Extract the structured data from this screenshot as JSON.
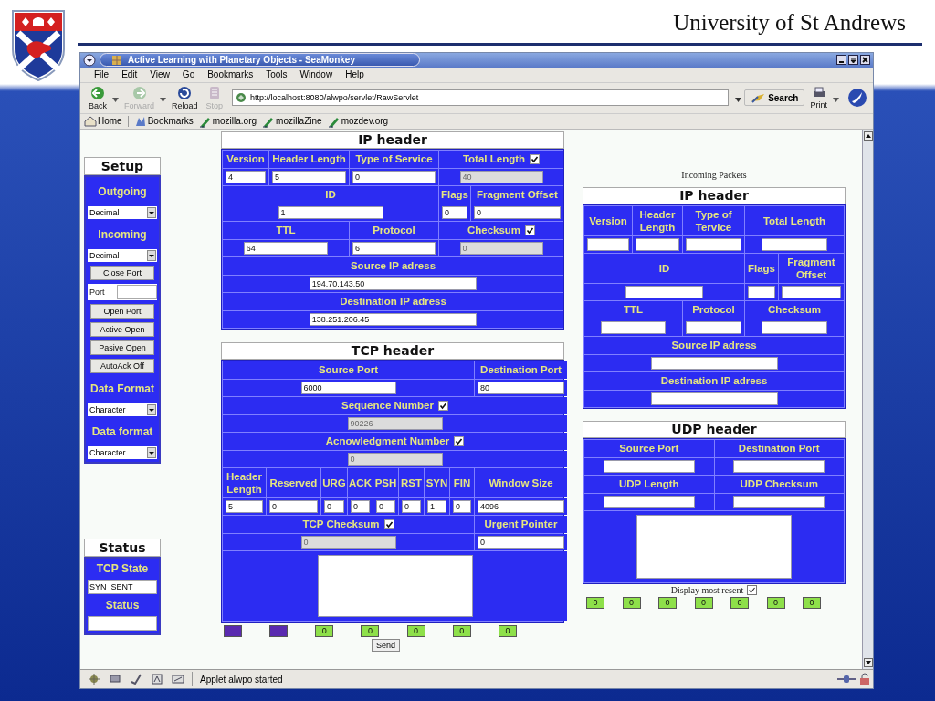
{
  "slide": {
    "title": "University of St Andrews"
  },
  "browser": {
    "title": "Active Learning with Planetary Objects - SeaMonkey",
    "menu": [
      "File",
      "Edit",
      "View",
      "Go",
      "Bookmarks",
      "Tools",
      "Window",
      "Help"
    ],
    "nav": [
      {
        "kind": "back",
        "label": "Back",
        "disabled": false
      },
      {
        "kind": "forward",
        "label": "Forward",
        "disabled": true
      },
      {
        "kind": "reload",
        "label": "Reload",
        "disabled": false
      },
      {
        "kind": "stop",
        "label": "Stop",
        "disabled": true
      }
    ],
    "url": "http://localhost:8080/alwpo/servlet/RawServlet",
    "search": "Search",
    "print": "Print",
    "bookmarks": [
      {
        "kind": "home",
        "label": "Home"
      },
      {
        "kind": "folder",
        "label": "Bookmarks"
      },
      {
        "kind": "link",
        "label": "mozilla.org"
      },
      {
        "kind": "link",
        "label": "mozillaZine"
      },
      {
        "kind": "link",
        "label": "mozdev.org"
      }
    ],
    "status_text": "Applet alwpo started"
  },
  "setup": {
    "title": "Setup",
    "items": [
      {
        "kind": "heading",
        "text": "Outgoing"
      },
      {
        "kind": "select",
        "value": "Decimal"
      },
      {
        "kind": "heading",
        "text": "Incoming"
      },
      {
        "kind": "select",
        "value": "Decimal"
      },
      {
        "kind": "button",
        "text": "Close Port"
      },
      {
        "kind": "port",
        "text": "Port"
      },
      {
        "kind": "button",
        "text": "Open Port"
      },
      {
        "kind": "button",
        "text": "Active Open"
      },
      {
        "kind": "button",
        "text": "Pasive Open"
      },
      {
        "kind": "button",
        "text": "AutoAck Off"
      },
      {
        "kind": "heading",
        "text": "Data Format"
      },
      {
        "kind": "select",
        "value": "Character"
      },
      {
        "kind": "heading",
        "text": "Data format"
      },
      {
        "kind": "select",
        "value": "Character"
      }
    ]
  },
  "status": {
    "title": "Status",
    "items": [
      {
        "kind": "heading",
        "text": "TCP State"
      },
      {
        "kind": "field",
        "value": "SYN_SENT"
      },
      {
        "kind": "heading",
        "text": "Status"
      },
      {
        "kind": "field"
      }
    ]
  },
  "ip_out": {
    "kind": "ip",
    "title": "IP header",
    "sections": [
      {
        "rows": [
          {
            "cells": [
              {
                "kind": "label",
                "text": "Version"
              },
              {
                "kind": "label",
                "text": "Header Length"
              },
              {
                "kind": "label",
                "text": "Type of Service"
              },
              {
                "kind": "label",
                "text": "Total Length",
                "checked": true
              }
            ]
          },
          {
            "cells": [
              {
                "kind": "input",
                "value": "4",
                "disabled": false
              },
              {
                "kind": "input",
                "value": "5",
                "disabled": false
              },
              {
                "kind": "input",
                "value": "0",
                "disabled": false
              },
              {
                "kind": "input",
                "value": "40",
                "disabled": true
              }
            ]
          }
        ]
      },
      {
        "rows": [
          {
            "cells": [
              {
                "kind": "label",
                "text": "ID"
              },
              {
                "kind": "label",
                "text": "Flags"
              },
              {
                "kind": "label",
                "text": "Fragment Offset"
              }
            ]
          },
          {
            "cells": [
              {
                "kind": "input",
                "value": "1",
                "disabled": false
              },
              {
                "kind": "input",
                "value": "0",
                "disabled": false
              },
              {
                "kind": "input",
                "value": "0",
                "disabled": false
              }
            ]
          }
        ]
      },
      {
        "rows": [
          {
            "cells": [
              {
                "kind": "label",
                "text": "TTL"
              },
              {
                "kind": "label",
                "text": "Protocol"
              },
              {
                "kind": "label",
                "text": "Checksum",
                "checked": true
              }
            ]
          },
          {
            "cells": [
              {
                "kind": "input",
                "value": "64",
                "disabled": false
              },
              {
                "kind": "input",
                "value": "6",
                "disabled": false
              },
              {
                "kind": "input",
                "value": "0",
                "disabled": true
              }
            ]
          }
        ]
      },
      {
        "rows": [
          {
            "cells": [
              {
                "kind": "label",
                "text": "Source IP adress"
              }
            ]
          },
          {
            "cells": [
              {
                "kind": "input",
                "value": "194.70.143.50",
                "disabled": false
              }
            ]
          }
        ]
      },
      {
        "rows": [
          {
            "cells": [
              {
                "kind": "label",
                "text": "Destination IP adress"
              }
            ]
          },
          {
            "cells": [
              {
                "kind": "input",
                "value": "138.251.206.45",
                "disabled": false
              }
            ]
          }
        ]
      }
    ]
  },
  "tcp_out": {
    "kind": "tcp",
    "title": "TCP header",
    "sections": [
      {
        "rows": [
          {
            "cells": [
              {
                "kind": "label",
                "text": "Source Port"
              },
              {
                "kind": "label",
                "text": "Destination Port"
              }
            ]
          },
          {
            "cells": [
              {
                "kind": "input",
                "value": "6000",
                "disabled": false
              },
              {
                "kind": "input",
                "value": "80",
                "disabled": false
              }
            ]
          }
        ]
      },
      {
        "rows": [
          {
            "cells": [
              {
                "kind": "label",
                "text": "Sequence Number",
                "checked": true
              }
            ]
          },
          {
            "cells": [
              {
                "kind": "input",
                "value": "90226",
                "disabled": true
              }
            ]
          }
        ]
      },
      {
        "rows": [
          {
            "cells": [
              {
                "kind": "label",
                "text": "Acnowledgment Number",
                "checked": true
              }
            ]
          },
          {
            "cells": [
              {
                "kind": "input",
                "value": "0",
                "disabled": true
              }
            ]
          }
        ]
      },
      {
        "rows": [
          {
            "cells": [
              {
                "kind": "label",
                "text": "Header Length"
              },
              {
                "kind": "label",
                "text": "Reserved"
              },
              {
                "kind": "label",
                "text": "URG"
              },
              {
                "kind": "label",
                "text": "ACK"
              },
              {
                "kind": "label",
                "text": "PSH"
              },
              {
                "kind": "label",
                "text": "RST"
              },
              {
                "kind": "label",
                "text": "SYN"
              },
              {
                "kind": "label",
                "text": "FIN"
              },
              {
                "kind": "label",
                "text": "Window Size"
              }
            ]
          },
          {
            "cells": [
              {
                "kind": "input",
                "value": "5",
                "disabled": false
              },
              {
                "kind": "input",
                "value": "0",
                "disabled": false
              },
              {
                "kind": "input",
                "value": "0",
                "disabled": false
              },
              {
                "kind": "input",
                "value": "0",
                "disabled": false
              },
              {
                "kind": "input",
                "value": "0",
                "disabled": false
              },
              {
                "kind": "input",
                "value": "0",
                "disabled": false
              },
              {
                "kind": "input",
                "value": "1",
                "disabled": false
              },
              {
                "kind": "input",
                "value": "0",
                "disabled": false
              },
              {
                "kind": "input",
                "value": "4096",
                "disabled": false
              }
            ]
          }
        ]
      },
      {
        "rows": [
          {
            "cells": [
              {
                "kind": "label",
                "text": "TCP Checksum",
                "checked": true
              },
              {
                "kind": "label",
                "text": "Urgent Pointer"
              }
            ]
          },
          {
            "cells": [
              {
                "kind": "input",
                "value": "0",
                "disabled": true
              },
              {
                "kind": "input",
                "value": "0",
                "disabled": false
              }
            ]
          }
        ]
      },
      {
        "rows": [
          {
            "cells": [
              {
                "kind": "textarea"
              }
            ]
          }
        ]
      }
    ]
  },
  "out_indicators": [
    {
      "color": "#5a2ab0"
    },
    {
      "color": "#5a2ab0"
    },
    {
      "label": "0",
      "color": "#8ee04a"
    },
    {
      "label": "0",
      "color": "#8ee04a"
    },
    {
      "label": "0",
      "color": "#8ee04a"
    },
    {
      "label": "0",
      "color": "#8ee04a"
    },
    {
      "label": "0",
      "color": "#8ee04a"
    }
  ],
  "send": "Send",
  "incoming_title": "Incoming Packets",
  "ip_in": {
    "kind": "ip",
    "title": "IP header",
    "sections": [
      {
        "rows": [
          {
            "cells": [
              {
                "kind": "label",
                "text": "Version"
              },
              {
                "kind": "label",
                "text": "Header Length"
              },
              {
                "kind": "label",
                "text": "Type of Tervice"
              },
              {
                "kind": "label",
                "text": "Total Length"
              }
            ]
          },
          {
            "cells": [
              {
                "kind": "input",
                "disabled": false
              },
              {
                "kind": "input",
                "disabled": false
              },
              {
                "kind": "input",
                "disabled": false
              },
              {
                "kind": "input",
                "disabled": false
              }
            ]
          }
        ]
      },
      {
        "rows": [
          {
            "cells": [
              {
                "kind": "label",
                "text": "ID"
              },
              {
                "kind": "label",
                "text": "Flags"
              },
              {
                "kind": "label",
                "text": "Fragment Offset"
              }
            ]
          },
          {
            "cells": [
              {
                "kind": "input",
                "disabled": false
              },
              {
                "kind": "input",
                "disabled": false
              },
              {
                "kind": "input",
                "disabled": false
              }
            ]
          }
        ]
      },
      {
        "rows": [
          {
            "cells": [
              {
                "kind": "label",
                "text": "TTL"
              },
              {
                "kind": "label",
                "text": "Protocol"
              },
              {
                "kind": "label",
                "text": "Checksum"
              }
            ]
          },
          {
            "cells": [
              {
                "kind": "input",
                "disabled": false
              },
              {
                "kind": "input",
                "disabled": false
              },
              {
                "kind": "input",
                "disabled": false
              }
            ]
          }
        ]
      },
      {
        "rows": [
          {
            "cells": [
              {
                "kind": "label",
                "text": "Source IP adress"
              }
            ]
          },
          {
            "cells": [
              {
                "kind": "input",
                "disabled": false
              }
            ]
          }
        ]
      },
      {
        "rows": [
          {
            "cells": [
              {
                "kind": "label",
                "text": "Destination IP adress"
              }
            ]
          },
          {
            "cells": [
              {
                "kind": "input",
                "disabled": false
              }
            ]
          }
        ]
      }
    ]
  },
  "udp_in": {
    "kind": "udp",
    "title": "UDP header",
    "sections": [
      {
        "rows": [
          {
            "cells": [
              {
                "kind": "label",
                "text": "Source Port"
              },
              {
                "kind": "label",
                "text": "Destination Port"
              }
            ]
          },
          {
            "cells": [
              {
                "kind": "input",
                "disabled": false
              },
              {
                "kind": "input",
                "disabled": false
              }
            ]
          }
        ]
      },
      {
        "rows": [
          {
            "cells": [
              {
                "kind": "label",
                "text": "UDP Length"
              },
              {
                "kind": "label",
                "text": "UDP Checksum"
              }
            ]
          },
          {
            "cells": [
              {
                "kind": "input",
                "disabled": false
              },
              {
                "kind": "input",
                "disabled": false
              }
            ]
          }
        ]
      },
      {
        "rows": [
          {
            "cells": [
              {
                "kind": "textarea"
              }
            ]
          }
        ]
      }
    ]
  },
  "display_recent": {
    "label": "Display most resent",
    "checked": true
  },
  "in_indicators": [
    {
      "label": "0",
      "color": "#8ee04a"
    },
    {
      "label": "0",
      "color": "#8ee04a"
    },
    {
      "label": "0",
      "color": "#8ee04a"
    },
    {
      "label": "0",
      "color": "#8ee04a"
    },
    {
      "label": "0",
      "color": "#8ee04a"
    },
    {
      "label": "0",
      "color": "#8ee04a"
    },
    {
      "label": "0",
      "color": "#8ee04a"
    }
  ]
}
